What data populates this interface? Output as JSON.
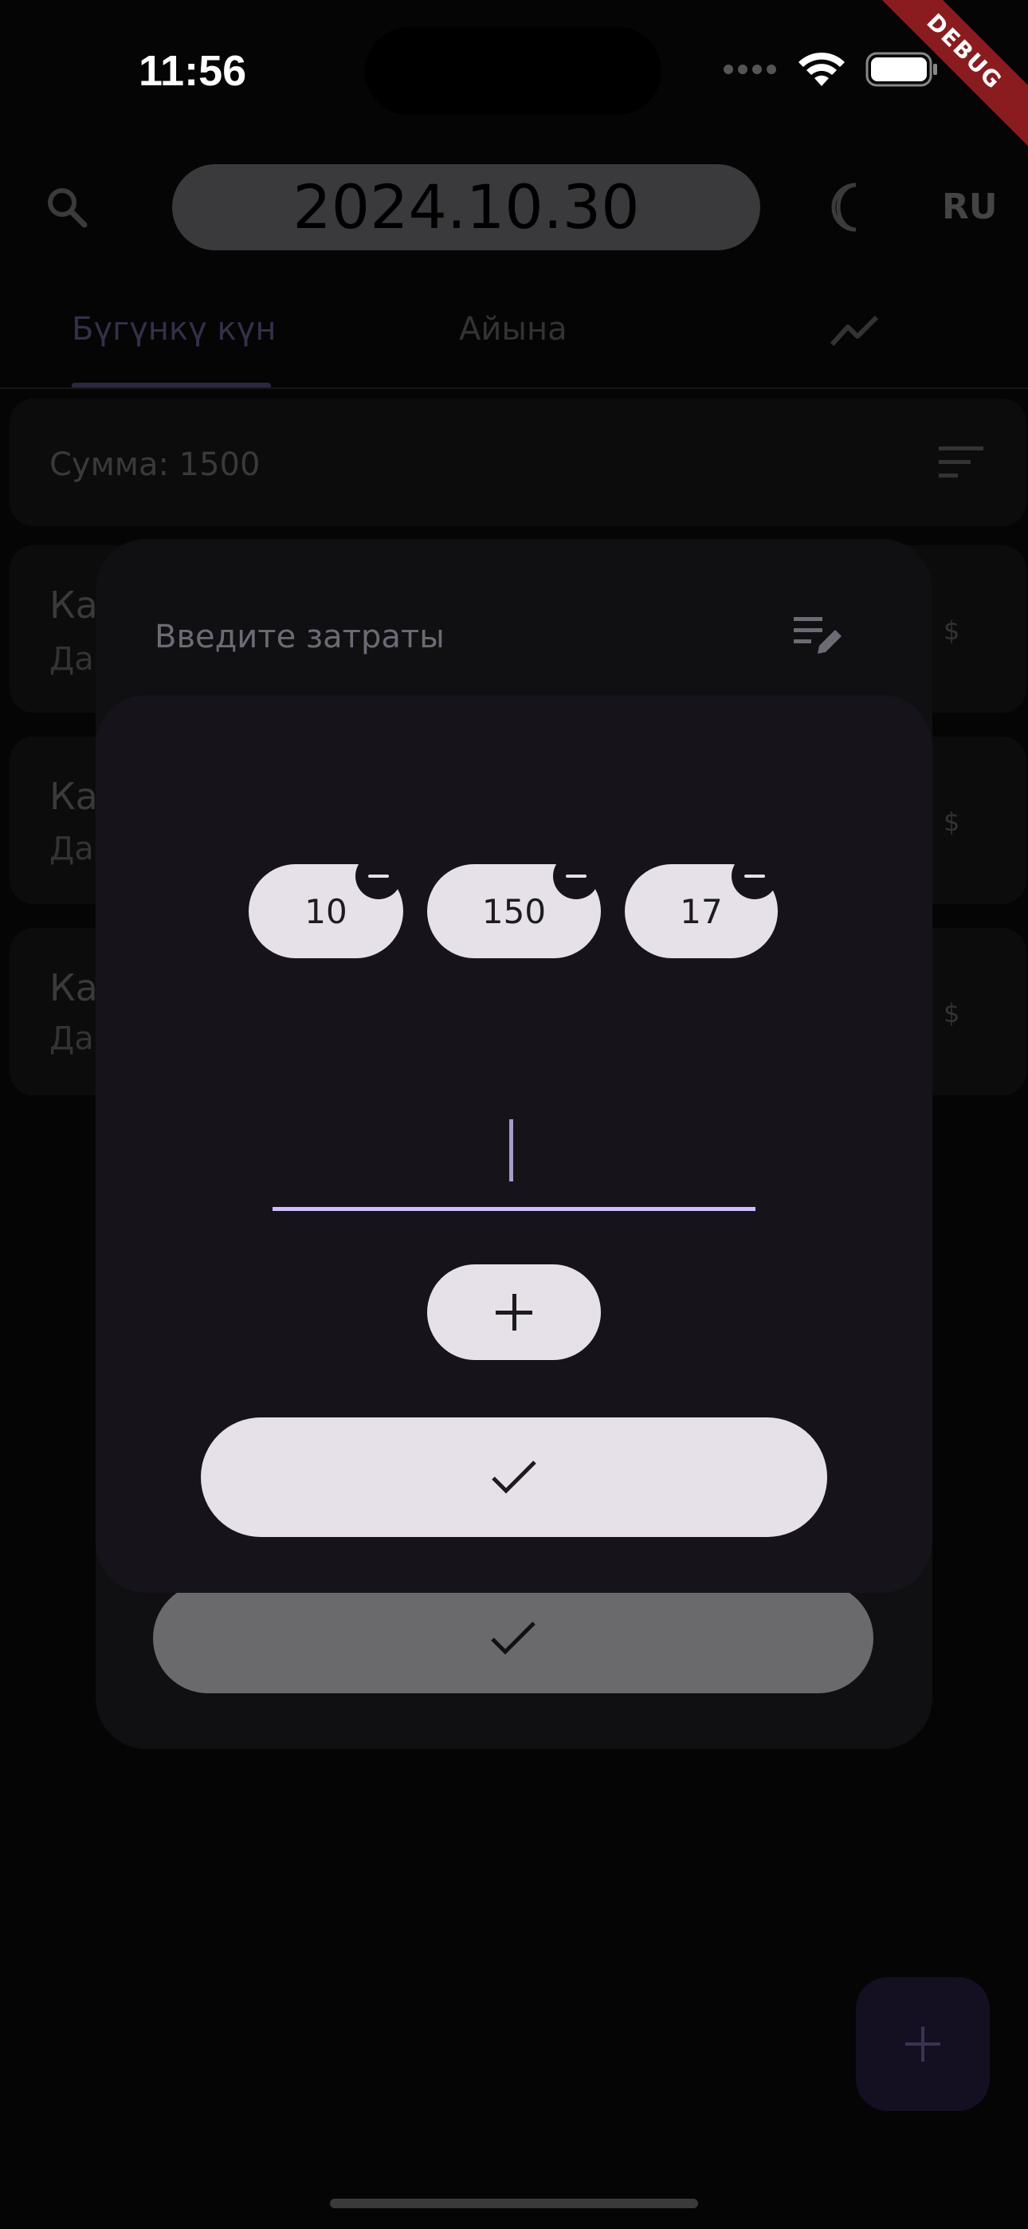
{
  "status_bar": {
    "time": "11:56",
    "debug_banner": "DEBUG"
  },
  "header": {
    "date": "2024.10.30",
    "language": "RU",
    "icons": [
      "search-icon",
      "moon-icon"
    ]
  },
  "tabs": [
    {
      "label": "Бүгүнкү күн",
      "selected": true
    },
    {
      "label": "Айына",
      "selected": false
    }
  ],
  "summary": {
    "label": "Сумма: 1500"
  },
  "expense_items": [
    {
      "title": "Ка",
      "subtitle": "Да",
      "currency": "$"
    },
    {
      "title": "Ка",
      "subtitle": "Да",
      "currency": "$"
    },
    {
      "title": "Ка",
      "subtitle": "Да",
      "currency": "$"
    }
  ],
  "outer_dialog": {
    "title": "Введите затраты"
  },
  "amount_dialog": {
    "chips": [
      "10",
      "150",
      "17"
    ],
    "input": {
      "value": "",
      "placeholder": ""
    }
  },
  "colors": {
    "accent": "#d0bcff",
    "dialog_background": "#16141a",
    "chip_background": "#e6e0e9",
    "scrim": "#050505"
  }
}
